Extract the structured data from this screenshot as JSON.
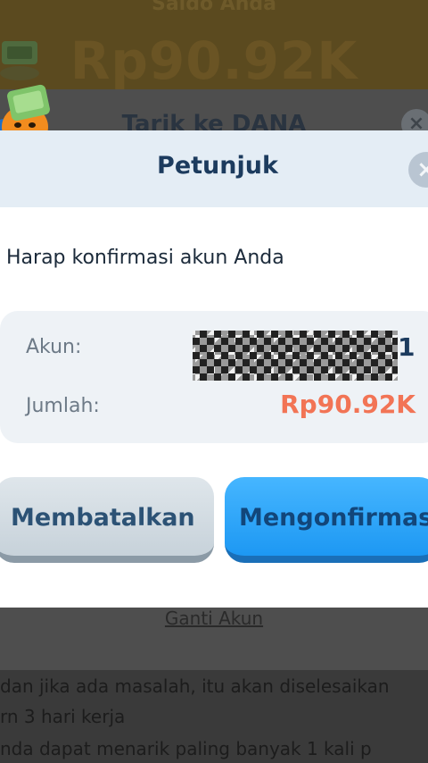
{
  "background": {
    "top_label": "Saldo Anda",
    "balance": "Rp90.92K",
    "tarik_title": "Tarik ke DANA",
    "ganti_akun": "Ganti Akun",
    "notes": [
      "dan jika ada masalah, itu akan diselesaikan",
      "rn 3 hari kerja",
      "nda dapat menarik paling banyak 1 kali p"
    ]
  },
  "dialog": {
    "title": "Petunjuk",
    "close_icon": "×",
    "message": "Harap konfirmasi akun Anda",
    "account_label": "Akun:",
    "account_tail": "1",
    "amount_label": "Jumlah:",
    "amount_value": "Rp90.92K",
    "amount_color": "#f27455",
    "cancel_label": "Membatalkan",
    "confirm_label": "Mengonfirmasi"
  },
  "icons": {
    "mascot": "money-mascot-icon",
    "close": "close-icon"
  }
}
